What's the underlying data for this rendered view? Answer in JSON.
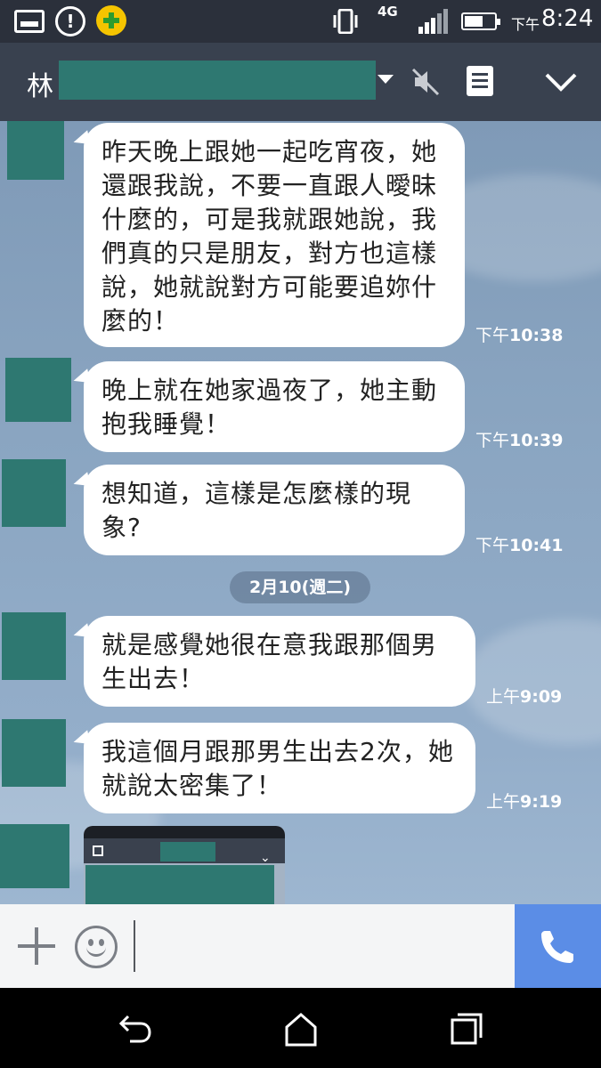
{
  "status_bar": {
    "network": "4G",
    "time_prefix": "下午",
    "time": "8:24"
  },
  "header": {
    "chat_name": "林"
  },
  "messages": [
    {
      "text": "昨天晚上跟她一起吃宵夜，她還跟我說，不要一直跟人曖昧什麼的，可是我就跟她說，我們真的只是朋友，對方也這樣說，她就說對方可能要追妳什麼的！",
      "time_prefix": "下午",
      "time": "10:38"
    },
    {
      "text": "晚上就在她家過夜了，她主動抱我睡覺！",
      "time_prefix": "下午",
      "time": "10:39"
    },
    {
      "text": "想知道，這樣是怎麼樣的現象?",
      "time_prefix": "下午",
      "time": "10:41"
    },
    {
      "text": "就是感覺她很在意我跟那個男生出去！",
      "time_prefix": "上午",
      "time": "9:09"
    },
    {
      "text": "我這個月跟那男生出去2次，她就說太密集了！",
      "time_prefix": "上午",
      "time": "9:19"
    }
  ],
  "date_separator": "2月10(週二)",
  "input": {
    "value": ""
  },
  "icons": {
    "mute": "speaker-mute-icon",
    "menu": "note-icon",
    "collapse": "chevron-down-icon",
    "plus": "plus-icon",
    "emoji": "smiley-icon",
    "call": "phone-icon",
    "back": "back-icon",
    "home": "home-icon",
    "recents": "recents-icon"
  },
  "colors": {
    "header": "#39414f",
    "status_bar": "#2b303b",
    "redaction": "#2e7871",
    "call_button": "#5b8de6",
    "bubble": "#ffffff"
  }
}
